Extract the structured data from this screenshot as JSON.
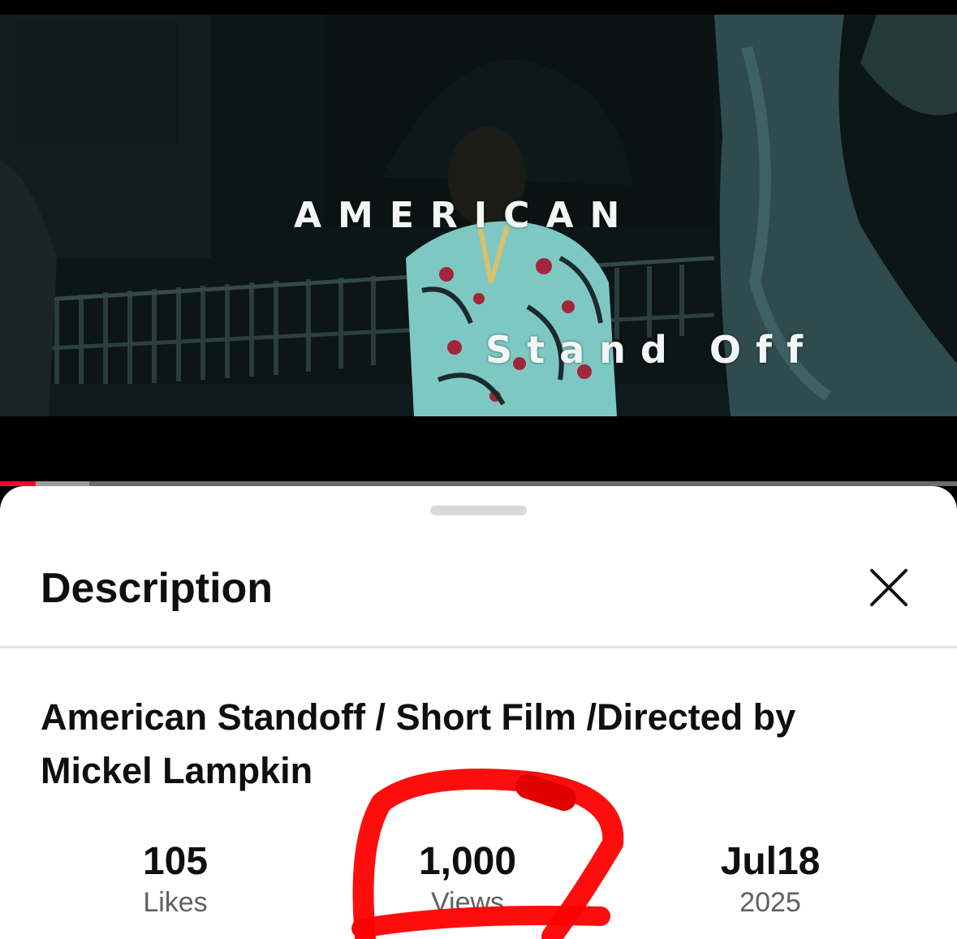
{
  "video": {
    "overlay_line1": "AMERICAN",
    "overlay_line2": "Stand Off",
    "progress_played_pct": 3.7,
    "progress_buffered_pct": 9.3
  },
  "sheet": {
    "heading": "Description",
    "close_icon": "close-icon",
    "title": "American Standoff / Short Film /Directed by Mickel Lampkin",
    "stats": [
      {
        "value": "105",
        "label": "Likes"
      },
      {
        "value": "1,000",
        "label": "Views"
      },
      {
        "value": "Jul18",
        "label": "2025"
      }
    ]
  },
  "colors": {
    "progress_played": "#ff0033",
    "annotation": "#ff0000"
  }
}
